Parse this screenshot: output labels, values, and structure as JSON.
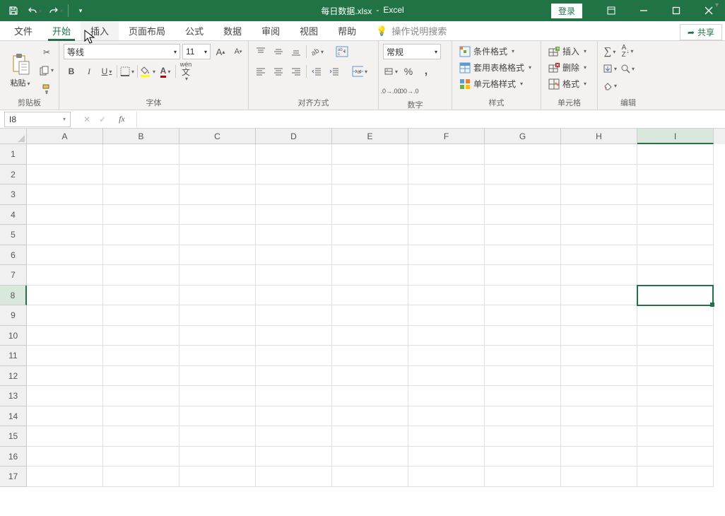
{
  "title": {
    "filename": "每日数据.xlsx",
    "app": "Excel",
    "sep": "-"
  },
  "login": "登录",
  "tabs": {
    "file": "文件",
    "home": "开始",
    "insert": "插入",
    "layout": "页面布局",
    "formulas": "公式",
    "data": "数据",
    "review": "审阅",
    "view": "视图",
    "help": "帮助",
    "search": "操作说明搜索"
  },
  "share": "共享",
  "ribbon": {
    "clipboard": {
      "paste": "粘贴",
      "label": "剪贴板"
    },
    "font": {
      "name": "等线",
      "size": "11",
      "label": "字体"
    },
    "align": {
      "label": "对齐方式"
    },
    "number": {
      "fmt": "常规",
      "label": "数字"
    },
    "styles": {
      "cond": "条件格式",
      "tbl": "套用表格格式",
      "cell": "单元格样式",
      "label": "样式"
    },
    "cells": {
      "insert": "插入",
      "delete": "删除",
      "format": "格式",
      "label": "单元格"
    },
    "editing": {
      "label": "编辑"
    }
  },
  "pinyin": "wén",
  "namebox": "I8",
  "cols": [
    "A",
    "B",
    "C",
    "D",
    "E",
    "F",
    "G",
    "H",
    "I"
  ],
  "rows": [
    "1",
    "2",
    "3",
    "4",
    "5",
    "6",
    "7",
    "8",
    "9",
    "10",
    "11",
    "12",
    "13",
    "14",
    "15",
    "16",
    "17"
  ],
  "selected_col": "I",
  "selected_row": "8"
}
